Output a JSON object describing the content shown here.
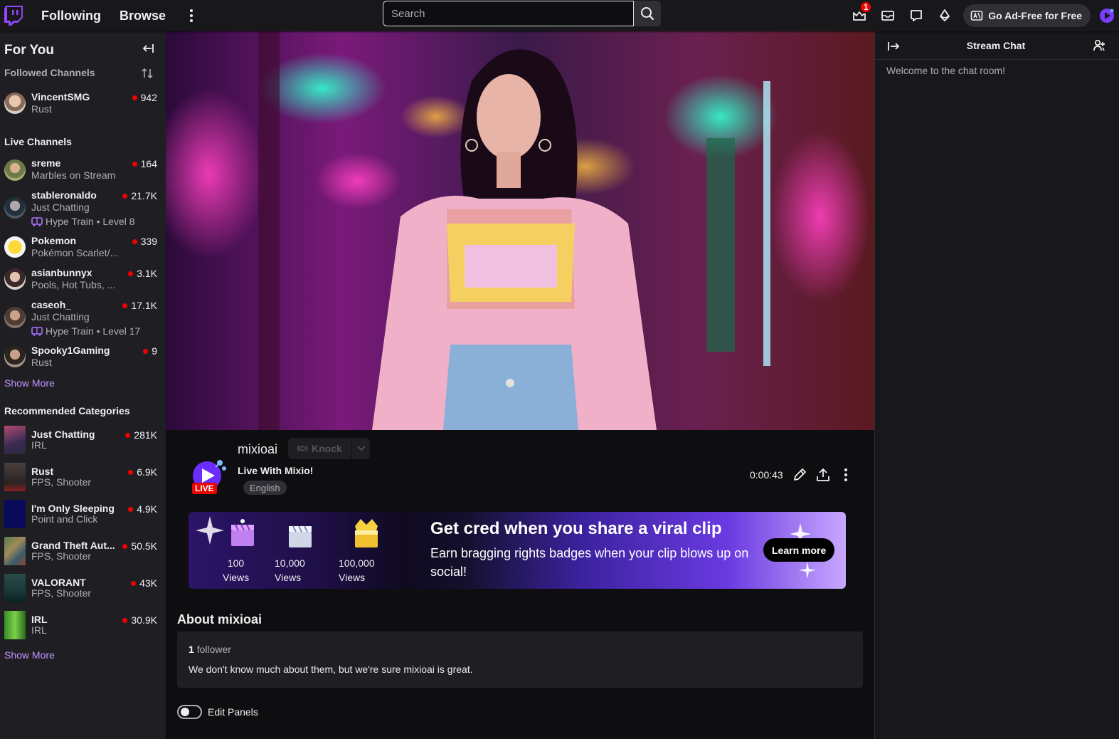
{
  "topnav": {
    "following": "Following",
    "browse": "Browse",
    "search_placeholder": "Search",
    "notification_count": "1",
    "ad_free": "Go Ad-Free for Free"
  },
  "sidebar": {
    "title": "For You",
    "followed_header": "Followed Channels",
    "followed": [
      {
        "name": "VincentSMG",
        "game": "Rust",
        "viewers": "942"
      }
    ],
    "live_header": "Live Channels",
    "live": [
      {
        "name": "sreme",
        "game": "Marbles on Stream",
        "viewers": "164"
      },
      {
        "name": "stableronaldo",
        "game": "Just Chatting",
        "viewers": "21.7K",
        "hype": "Hype Train • Level 8"
      },
      {
        "name": "Pokemon",
        "game": "Pokémon Scarlet/...",
        "viewers": "339"
      },
      {
        "name": "asianbunnyx",
        "game": "Pools, Hot Tubs, ...",
        "viewers": "3.1K"
      },
      {
        "name": "caseoh_",
        "game": "Just Chatting",
        "viewers": "17.1K",
        "hype": "Hype Train • Level 17"
      },
      {
        "name": "Spooky1Gaming",
        "game": "Rust",
        "viewers": "9"
      }
    ],
    "show_more_1": "Show More",
    "rec_header": "Recommended Categories",
    "categories": [
      {
        "name": "Just Chatting",
        "tags": "IRL",
        "viewers": "281K"
      },
      {
        "name": "Rust",
        "tags": "FPS, Shooter",
        "viewers": "6.9K"
      },
      {
        "name": "I'm Only Sleeping",
        "tags": "Point and Click",
        "viewers": "4.9K"
      },
      {
        "name": "Grand Theft Aut...",
        "tags": "FPS, Shooter",
        "viewers": "50.5K"
      },
      {
        "name": "VALORANT",
        "tags": "FPS, Shooter",
        "viewers": "43K"
      },
      {
        "name": "IRL",
        "tags": "IRL",
        "viewers": "30.9K"
      }
    ],
    "show_more_2": "Show More"
  },
  "stream": {
    "channel": "mixioai",
    "knock": "Knock",
    "title": "Live With Mixio!",
    "language": "English",
    "live_label": "LIVE",
    "uptime": "0:00:43"
  },
  "promo": {
    "badges": [
      {
        "count": "100",
        "unit": "Views"
      },
      {
        "count": "10,000",
        "unit": "Views"
      },
      {
        "count": "100,000",
        "unit": "Views"
      }
    ],
    "heading": "Get cred when you share a viral clip",
    "desc": "Earn bragging rights badges when your clip blows up on social!",
    "button": "Learn more"
  },
  "about": {
    "heading": "About mixioai",
    "followers": "1",
    "followers_label": "follower",
    "description": "We don't know much about them, but we're sure mixioai is great.",
    "edit_panels": "Edit Panels"
  },
  "chat": {
    "title": "Stream Chat",
    "welcome": "Welcome to the chat room!"
  }
}
